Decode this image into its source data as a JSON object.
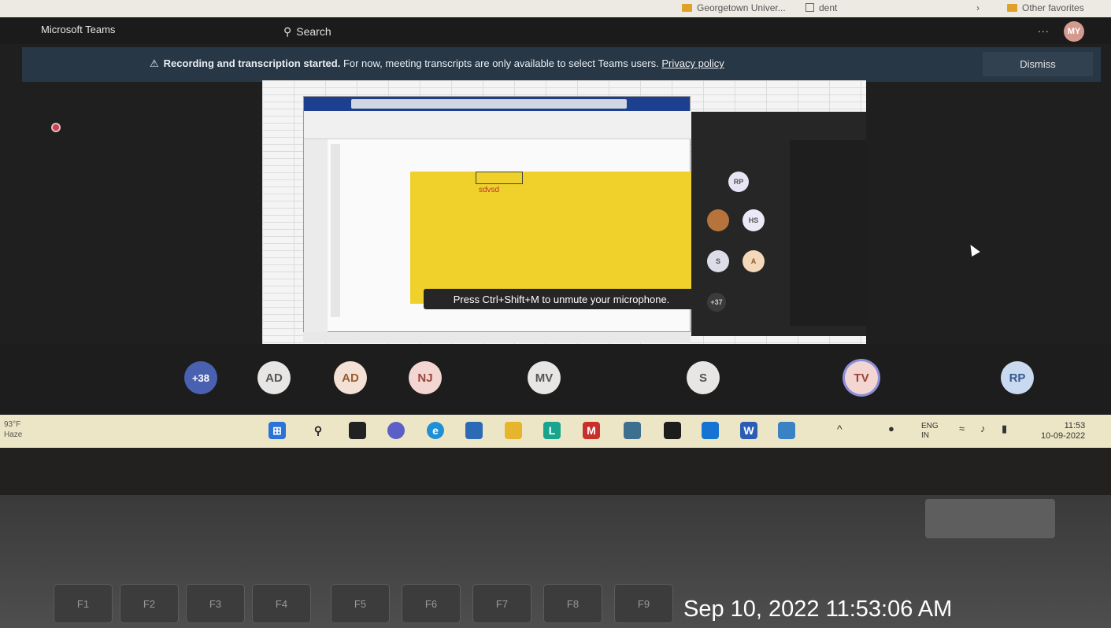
{
  "browser": {
    "favorites": [
      "Georgetown Univer...",
      "dent",
      "Other favorites"
    ]
  },
  "teams": {
    "app_title": "Microsoft Teams",
    "search_placeholder": "Search",
    "more_label": "...",
    "user_initials": "MY",
    "banner": {
      "bold": "Recording and transcription started.",
      "text": "For now, meeting transcripts are only available to select Teams users.",
      "link": "Privacy policy",
      "dismiss": "Dismiss"
    },
    "shared_screen": {
      "cell_text": "sdvsd",
      "tooltip": "Press Ctrl+Shift+M to unmute your microphone.",
      "mini_participants": [
        "RP",
        "HS",
        "S",
        "A"
      ],
      "mini_more": "+37"
    },
    "participants": [
      {
        "label": "+38"
      },
      {
        "label": "AD"
      },
      {
        "label": "AD"
      },
      {
        "label": "NJ"
      },
      {
        "label": "MV"
      },
      {
        "label": "S"
      },
      {
        "label": "TV"
      },
      {
        "label": "RP"
      }
    ]
  },
  "taskbar": {
    "weather_temp": "93°F",
    "weather_desc": "Haze",
    "lang_top": "ENG",
    "lang_bottom": "IN",
    "time": "11:53",
    "date": "10-09-2022"
  },
  "keyboard_keys": [
    "F1",
    "F2",
    "F3",
    "F4",
    "F5",
    "F6",
    "F7",
    "F8",
    "F9"
  ],
  "photo_timestamp": "Sep 10, 2022 11:53:06 AM"
}
